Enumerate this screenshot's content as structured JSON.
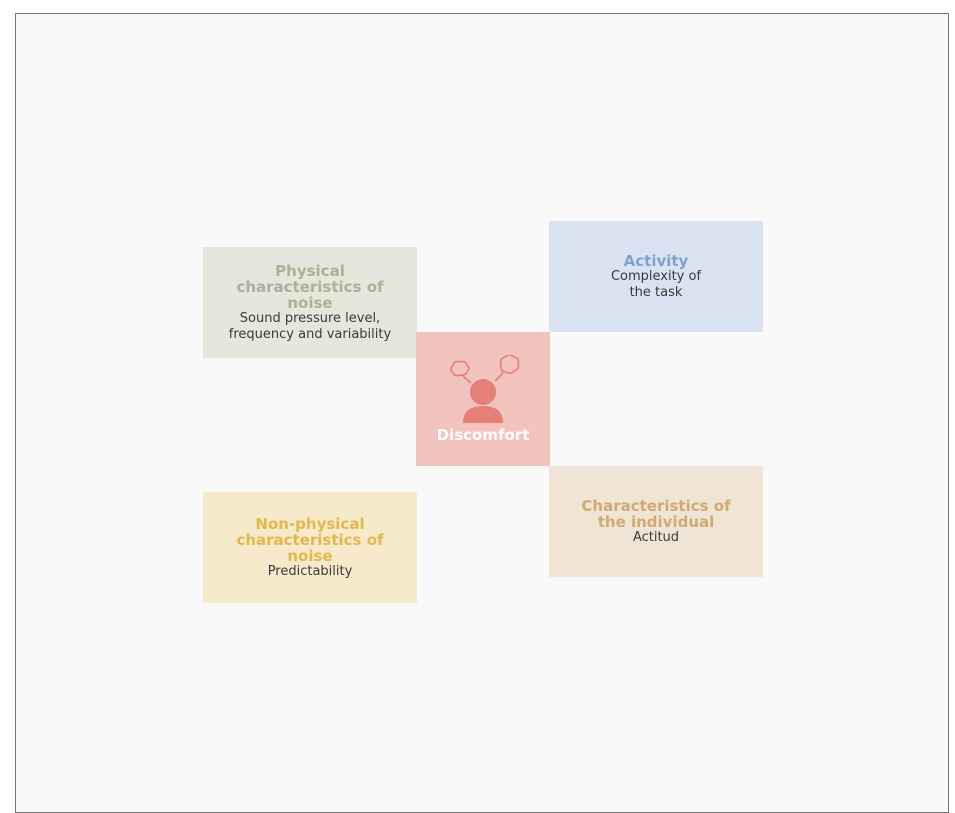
{
  "diagram": {
    "center": {
      "label": "Discomfort",
      "icon": "stressed-person-icon",
      "color": "#e57f77"
    },
    "factors": {
      "physical": {
        "title": "Physical characteristics of noise",
        "description": "Sound pressure level, frequency and variability",
        "accent": "#a9b296"
      },
      "activity": {
        "title": "Activity",
        "description": "Complexity of the task",
        "accent": "#7ea2cf"
      },
      "nonphysical": {
        "title": "Non-physical characteristics of noise",
        "description": "Predictability",
        "accent": "#e2b84e"
      },
      "individual": {
        "title": "Characteristics of the individual",
        "description": "Actitud",
        "accent": "#cfaa73"
      }
    }
  }
}
